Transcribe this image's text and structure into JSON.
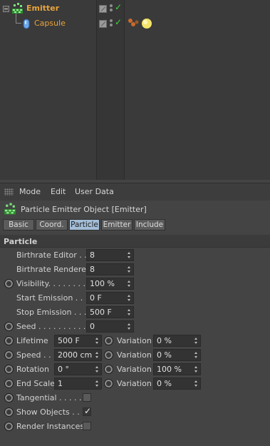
{
  "object_manager": {
    "objects": [
      {
        "name": "Emitter",
        "color": "#e8a33b",
        "icon": "emitter-icon",
        "expanded": true
      },
      {
        "name": "Capsule",
        "color": "#e8a33b",
        "icon": "capsule-icon"
      }
    ]
  },
  "attribute_manager": {
    "menu": [
      "Mode",
      "Edit",
      "User Data"
    ],
    "title": "Particle Emitter Object [Emitter]",
    "tabs": [
      "Basic",
      "Coord.",
      "Particle",
      "Emitter",
      "Include"
    ],
    "active_tab": "Particle",
    "section": "Particle",
    "params": {
      "birthrate_editor": {
        "label": "Birthrate Editor . .",
        "value": "8"
      },
      "birthrate_renderer": {
        "label": "Birthrate Renderer",
        "value": "8"
      },
      "visibility": {
        "label": "Visibility. . . . . . . .",
        "value": "100 %"
      },
      "start_emission": {
        "label": "Start Emission . . .",
        "value": "0 F"
      },
      "stop_emission": {
        "label": "Stop Emission . . .",
        "value": "500 F"
      },
      "seed": {
        "label": "Seed . . . . . . . . . . .",
        "value": "0"
      },
      "lifetime": {
        "label": "Lifetime",
        "value": "500 F",
        "variation_label": "Variation",
        "variation": "0 %"
      },
      "speed": {
        "label": "Speed . . .",
        "value": "2000 cm",
        "variation_label": "Variation",
        "variation": "0 %"
      },
      "rotation": {
        "label": "Rotation",
        "value": "0 °",
        "variation_label": "Variation",
        "variation": "100 %"
      },
      "end_scale": {
        "label": "End Scale",
        "value": "1",
        "variation_label": "Variation",
        "variation": "0 %"
      },
      "tangential": {
        "label": "Tangential . . . . .",
        "checked": false
      },
      "show_objects": {
        "label": "Show Objects . .",
        "checked": true
      },
      "render_instances": {
        "label": "Render Instances",
        "checked": false
      }
    }
  },
  "colors": {
    "active_tab": "#a3bdd7",
    "object_name": "#e8a33b",
    "check_green": "#44d344"
  }
}
